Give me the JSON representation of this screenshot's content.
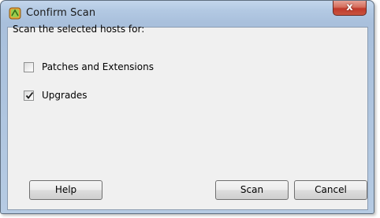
{
  "window": {
    "title": "Confirm Scan",
    "close_glyph": "x",
    "icon": "vsphere-app-icon"
  },
  "dialog": {
    "heading": "Scan the selected hosts for:",
    "options": [
      {
        "label": "Patches and Extensions",
        "checked": false
      },
      {
        "label": "Upgrades",
        "checked": true
      }
    ]
  },
  "buttons": {
    "help": "Help",
    "scan": "Scan",
    "cancel": "Cancel"
  },
  "colors": {
    "titlebar": "#b3c9e3",
    "close_button": "#c9543f",
    "client_bg": "#f0f0f0"
  }
}
